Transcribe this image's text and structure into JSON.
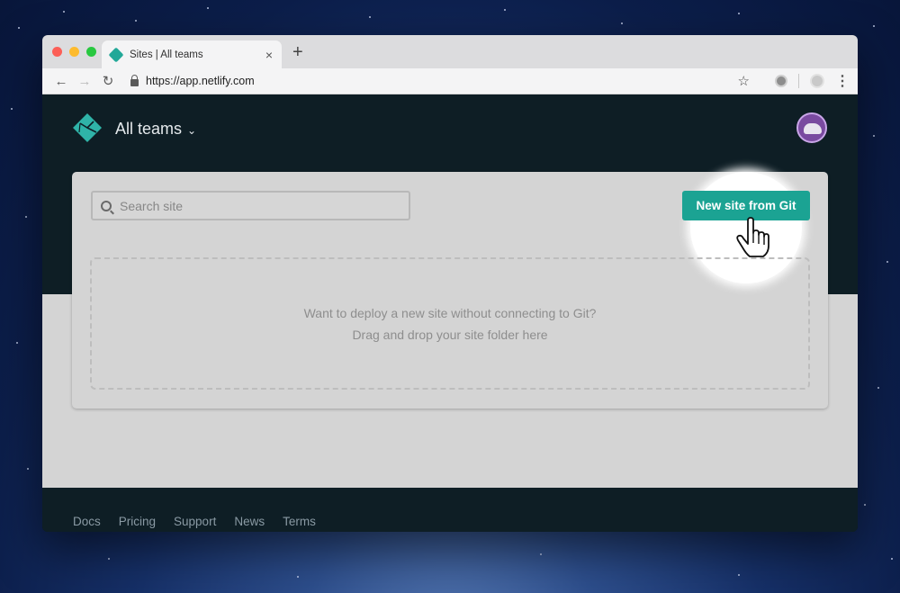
{
  "browser": {
    "tab_title": "Sites | All teams",
    "new_tab": "+",
    "close": "×",
    "url": "https://app.netlify.com"
  },
  "app": {
    "team_name": "All teams",
    "search_placeholder": "Search site",
    "new_site_button": "New site from Git",
    "dropzone": {
      "line1": "Want to deploy a new site without connecting to Git?",
      "line2": "Drag and drop your site folder here"
    }
  },
  "footer": {
    "links": [
      "Docs",
      "Pricing",
      "Support",
      "News",
      "Terms"
    ]
  },
  "colors": {
    "accent": "#1ba393",
    "header_bg": "#0e1e25"
  },
  "icons": [
    "netlify-logo-icon",
    "chevron-down-icon",
    "search-icon",
    "hand-pointer-cursor-icon",
    "lock-icon",
    "star-icon"
  ]
}
